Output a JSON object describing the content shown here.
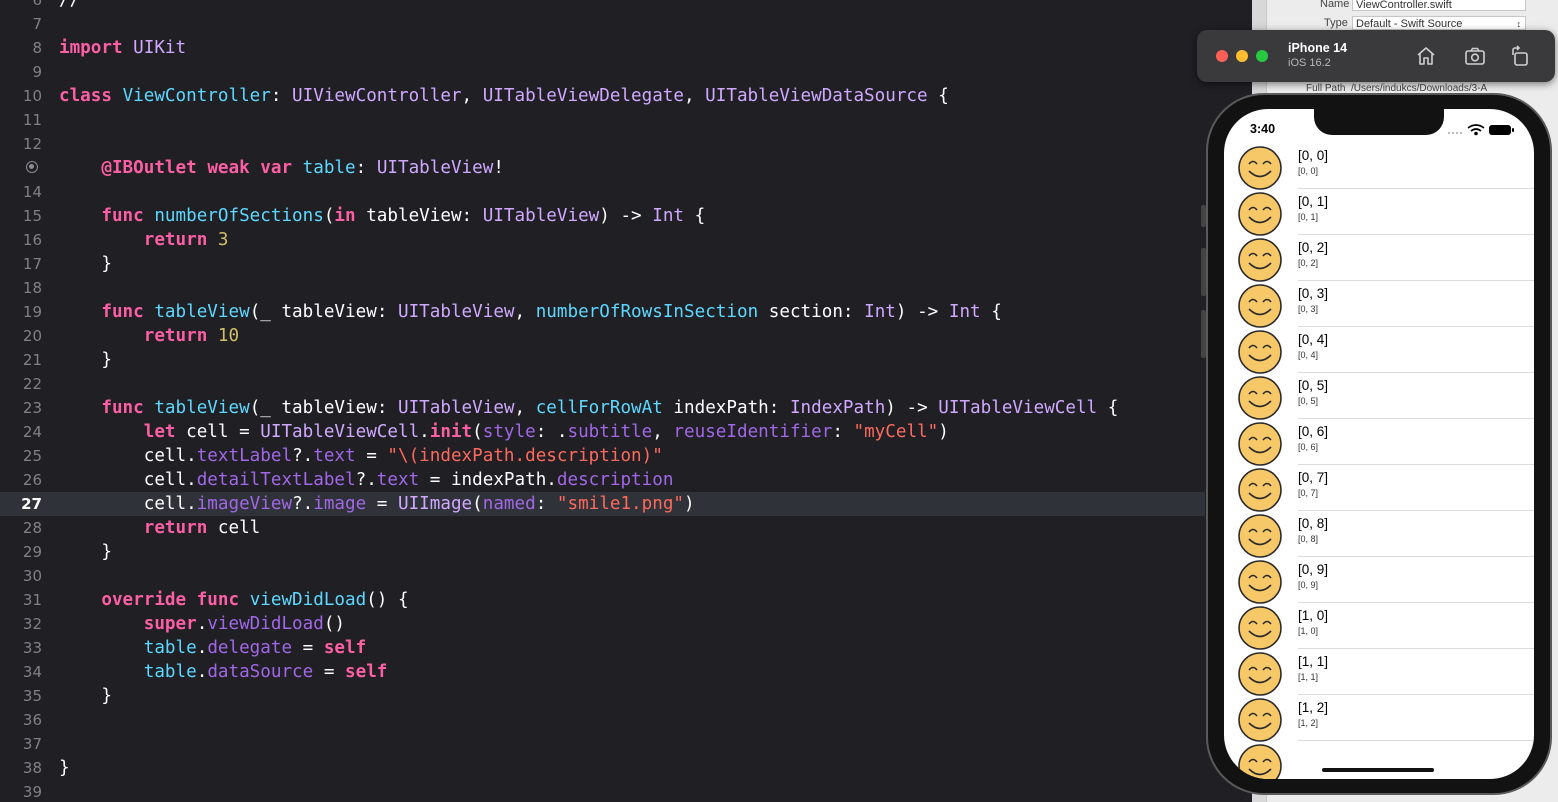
{
  "editor": {
    "current_line": "27",
    "lines": [
      {
        "n": "6",
        "code": "//"
      },
      {
        "n": "7",
        "code": ""
      },
      {
        "n": "8",
        "code": "import UIKit"
      },
      {
        "n": "9",
        "code": ""
      },
      {
        "n": "10",
        "code": "class ViewController: UIViewController, UITableViewDelegate, UITableViewDataSource {"
      },
      {
        "n": "11",
        "code": ""
      },
      {
        "n": "12",
        "code": ""
      },
      {
        "n": "",
        "code": "    @IBOutlet weak var table: UITableView!"
      },
      {
        "n": "14",
        "code": ""
      },
      {
        "n": "15",
        "code": "    func numberOfSections(in tableView: UITableView) -> Int {"
      },
      {
        "n": "16",
        "code": "        return 3"
      },
      {
        "n": "17",
        "code": "    }"
      },
      {
        "n": "18",
        "code": ""
      },
      {
        "n": "19",
        "code": "    func tableView(_ tableView: UITableView, numberOfRowsInSection section: Int) -> Int {"
      },
      {
        "n": "20",
        "code": "        return 10"
      },
      {
        "n": "21",
        "code": "    }"
      },
      {
        "n": "22",
        "code": ""
      },
      {
        "n": "23",
        "code": "    func tableView(_ tableView: UITableView, cellForRowAt indexPath: IndexPath) -> UITableViewCell {"
      },
      {
        "n": "24",
        "code": "        let cell = UITableViewCell.init(style: .subtitle, reuseIdentifier: \"myCell\")"
      },
      {
        "n": "25",
        "code": "        cell.textLabel?.text = \"\\(indexPath.description)\""
      },
      {
        "n": "26",
        "code": "        cell.detailTextLabel?.text = indexPath.description"
      },
      {
        "n": "27",
        "code": "        cell.imageView?.image = UIImage(named: \"smile1.png\")"
      },
      {
        "n": "28",
        "code": "        return cell"
      },
      {
        "n": "29",
        "code": "    }"
      },
      {
        "n": "30",
        "code": ""
      },
      {
        "n": "31",
        "code": "    override func viewDidLoad() {"
      },
      {
        "n": "32",
        "code": "        super.viewDidLoad()"
      },
      {
        "n": "33",
        "code": "        table.delegate = self"
      },
      {
        "n": "34",
        "code": "        table.dataSource = self"
      },
      {
        "n": "35",
        "code": "    }"
      },
      {
        "n": "36",
        "code": ""
      },
      {
        "n": "37",
        "code": ""
      },
      {
        "n": "38",
        "code": "}"
      },
      {
        "n": "39",
        "code": ""
      }
    ]
  },
  "inspector": {
    "name_label": "Name",
    "name_value": "ViewController.swift",
    "type_label": "Type",
    "type_value": "Default - Swift Source",
    "fullpath_label": "Full Path",
    "fullpath_value": "/Users/indukcs/Downloads/3-A"
  },
  "simulator": {
    "device_name": "iPhone 14",
    "os_version": "iOS 16.2",
    "status_time": "3:40",
    "rows": [
      {
        "title": "[0, 0]",
        "subtitle": "[0, 0]"
      },
      {
        "title": "[0, 1]",
        "subtitle": "[0, 1]"
      },
      {
        "title": "[0, 2]",
        "subtitle": "[0, 2]"
      },
      {
        "title": "[0, 3]",
        "subtitle": "[0, 3]"
      },
      {
        "title": "[0, 4]",
        "subtitle": "[0, 4]"
      },
      {
        "title": "[0, 5]",
        "subtitle": "[0, 5]"
      },
      {
        "title": "[0, 6]",
        "subtitle": "[0, 6]"
      },
      {
        "title": "[0, 7]",
        "subtitle": "[0, 7]"
      },
      {
        "title": "[0, 8]",
        "subtitle": "[0, 8]"
      },
      {
        "title": "[0, 9]",
        "subtitle": "[0, 9]"
      },
      {
        "title": "[1, 0]",
        "subtitle": "[1, 0]"
      },
      {
        "title": "[1, 1]",
        "subtitle": "[1, 1]"
      },
      {
        "title": "[1, 2]",
        "subtitle": "[1, 2]"
      }
    ]
  },
  "colors": {
    "editor_bg": "#1f1f24",
    "current_line_bg": "#2f3239",
    "keyword": "#fc5fa3",
    "type": "#d0a8ff",
    "string": "#fc6a5d",
    "number": "#d0bf69"
  },
  "icons": {
    "breakpoint_marker": "breakpoint-outlet-icon",
    "toolbar": [
      "home-icon",
      "screenshot-icon",
      "rotate-icon"
    ],
    "cell_image": "smile-face-icon"
  }
}
